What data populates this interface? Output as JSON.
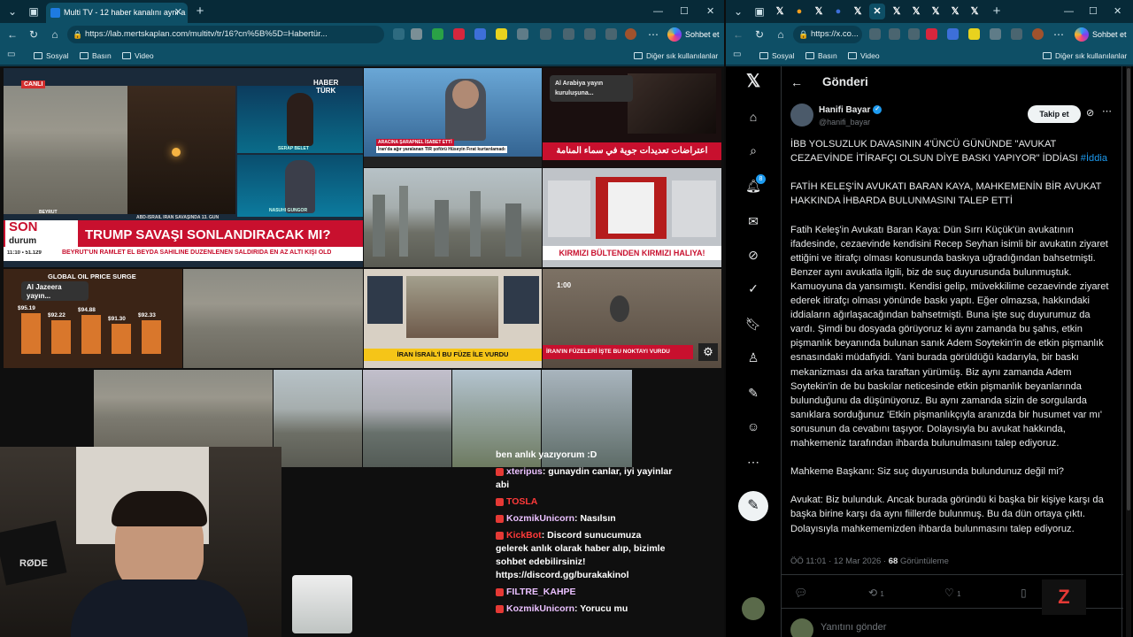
{
  "left_window": {
    "tab_title": "Multi TV - 12 haber kanalını aynı a",
    "url": "https://lab.mertskaplan.com/multitv/tr/16?cn%5B%5D=Habertür...",
    "sohbet_label": "Sohbet et",
    "bookmarks": [
      "Sosyal",
      "Basın",
      "Video"
    ],
    "other_favorites": "Diğer sık kullanılanlar"
  },
  "right_window": {
    "url": "https://x.co...",
    "sohbet_label": "Sohbet et",
    "bookmarks": [
      "Sosyal",
      "Basın",
      "Video"
    ],
    "other_favorites": "Diğer sık kullanılanlar"
  },
  "tv": {
    "haberturk": {
      "canli": "CANLI",
      "logo_line1": "HABER",
      "logo_line2": "TÜRK",
      "anchor_name": "SERAP BELET",
      "guest_name": "NASUHİ GÜNGÖR",
      "location": "BEYRUT",
      "strap": "ABD-İSRAİL İRAN SAVAŞINDA 13. GÜN",
      "son_durum_1": "SON",
      "son_durum_2": "durum",
      "headline": "TRUMP SAVAŞI SONLANDIRACAK MI?",
      "time": "11:10",
      "index_value": "51.129",
      "ticker": "BEYRUT'UN RAMLET EL BEYDA SAHİLİNE DÜZENLENEN SALDIRIDA EN AZ ALTI KİŞİ ÖLD"
    },
    "cnnturk_strap": "ARACINA ŞARAPNEL İSABET ETTİ",
    "cnnturk_sub": "İran'da ağır yaralanan TIR şoförü Hüseyin Fırat kurtarılamadı",
    "alarabiya_popup": "Al Arabiya yayın kuruluşuna...",
    "alarabiya_arabic": "اعتراضات تعديدات جوية في سماء المنامة",
    "kirmizi_bulten": "KIRMIZI BÜLTENDEN KIRMIZI HALIYA!",
    "aljazeera_popup": "Al Jazeera yayın...",
    "oil_title": "GLOBAL OIL PRICE SURGE",
    "oil_values": [
      "$95.19",
      "$92.22",
      "$94.88",
      "$91.30",
      "$92.33"
    ],
    "israil_strap": "İRAN İSRAİL'İ BU FÜZE İLE VURDU",
    "iran_strap": "İRAN'IN FÜZELERİ İŞTE BU NOKTAYI VURDU",
    "timestamp_overlay": "1:00"
  },
  "chat": {
    "first_line": "ben anlık yazıyorum :D",
    "messages": [
      {
        "user": "xteripus",
        "text": "gunaydin canlar, iyi yayinlar abi",
        "red": false
      },
      {
        "user": "TOSLA",
        "text": "",
        "red": true
      },
      {
        "user": "KozmikUnicorn",
        "text": "Nasılsın",
        "red": false
      },
      {
        "user": "KickBot",
        "text": "Discord sunucumuza gelerek anlık olarak haber alıp, bizimle sohbet edebilirsiniz! https://discord.gg/burakakinol",
        "red": true
      },
      {
        "user": "FILTRE_KAHPE",
        "text": "",
        "red": false
      },
      {
        "user": "KozmikUnicorn",
        "text": "Yorucu mu",
        "red": false
      }
    ],
    "mic_brand": "RØDE"
  },
  "x_post": {
    "header_title": "Gönderi",
    "author_name": "Hanifi Bayar",
    "author_handle": "@hanifi_bayar",
    "follow_label": "Takip et",
    "title_line": "İBB YOLSUZLUK DAVASININ 4'ÜNCÜ GÜNÜNDE \"AVUKAT CEZAEVİNDE İTİRAFÇI OLSUN DİYE BASKI YAPIYOR\" İDDİASI",
    "hashtag": "#İddia",
    "subtitle": "FATİH KELEŞ'İN AVUKATI BARAN KAYA, MAHKEMENİN BİR AVUKAT HAKKINDA İHBARDA BULUNMASINI TALEP ETTİ",
    "body": "Fatih Keleş'in Avukatı Baran Kaya: Dün Sırrı Küçük'ün avukatının ifadesinde, cezaevinde kendisini Recep Seyhan isimli bir avukatın ziyaret ettiğini ve itirafçı olması konusunda baskıya uğradığından bahsetmişti. Benzer aynı avukatla ilgili, biz de suç duyurusunda bulunmuştuk. Kamuoyuna da yansımıştı. Kendisi gelip, müvekkilime cezaevinde ziyaret ederek itirafçı olması yönünde baskı yaptı. Eğer olmazsa, hakkındaki iddiaların ağırlaşacağından bahsetmişti. Buna işte suç duyurumuz da vardı. Şimdi bu dosyada görüyoruz ki aynı zamanda bu şahıs, etkin pişmanlık beyanında bulunan sanık Adem Soytekin'in de etkin pişmanlık esnasındaki müdafiyidi. Yani burada görüldüğü kadarıyla, bir baskı mekanizması da arka taraftan yürümüş. Biz aynı zamanda Adem Soytekin'in de bu baskılar neticesinde etkin pişmanlık beyanlarında bulunduğunu da düşünüyoruz. Bu aynı zamanda sizin de sorgularda sanıklara sorduğunuz 'Etkin pişmanlıkçıyla aranızda bir husumet var mı' sorusunun da cevabını taşıyor. Dolayısıyla bu avukat hakkında, mahkemeniz tarafından ihbarda bulunulmasını talep ediyoruz.",
    "para2": "Mahkeme Başkanı: Siz suç duyurusunda bulundunuz değil mi?",
    "para3": "Avukat: Biz bulunduk. Ancak burada göründü ki başka bir kişiye karşı da başka birine karşı da aynı fiillerde bulunmuş. Bu da dün ortaya çıktı. Dolayısıyla mahkememizden ihbarda bulunmasını talep ediyoruz.",
    "meta_time": "ÖÖ 11:01 · 12 Mar 2026 ·",
    "views_count": "68",
    "views_label": "Görüntüleme",
    "retweets": "1",
    "likes": "1",
    "reply_placeholder": "Yanıtını gönder",
    "notif_count": "8"
  },
  "colors": {
    "browser_frame": "#0e4f66",
    "x_blue": "#1d9bf0",
    "haberturk_red": "#c8102e"
  }
}
